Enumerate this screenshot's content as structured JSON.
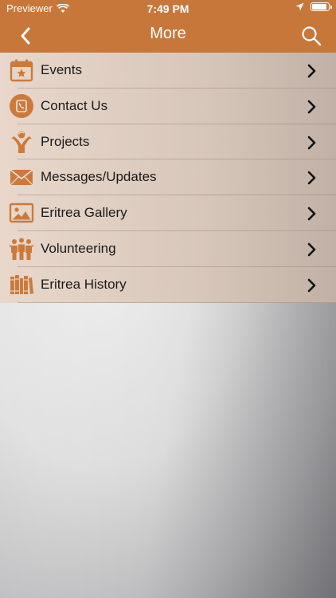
{
  "status_bar": {
    "carrier": "Previewer",
    "time": "7:49 PM"
  },
  "nav": {
    "title": "More"
  },
  "menu": {
    "items": [
      {
        "label": "Events",
        "icon": "calendar-star-icon"
      },
      {
        "label": "Contact Us",
        "icon": "phone-circle-icon"
      },
      {
        "label": "Projects",
        "icon": "helping-hands-icon"
      },
      {
        "label": "Messages/Updates",
        "icon": "envelope-icon"
      },
      {
        "label": "Eritrea Gallery",
        "icon": "picture-icon"
      },
      {
        "label": "Volunteering",
        "icon": "people-group-icon"
      },
      {
        "label": "Eritrea History",
        "icon": "books-icon"
      }
    ]
  },
  "colors": {
    "accent": "#c7773a",
    "icon": "#cc7a3c"
  }
}
